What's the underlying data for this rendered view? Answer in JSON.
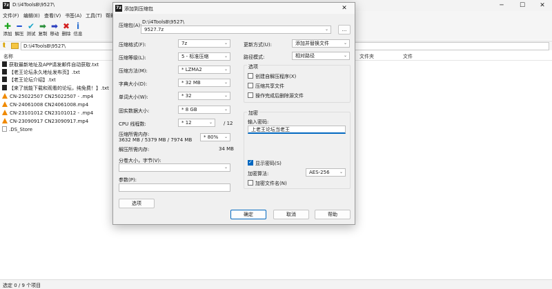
{
  "window": {
    "title": "D:\\i4ToolsB\\9527\\"
  },
  "menu": [
    "文件(F)",
    "编辑(E)",
    "查看(V)",
    "书签(A)",
    "工具(T)",
    "帮助"
  ],
  "toolbar": [
    {
      "label": "添加",
      "icon": "add-icon",
      "glyph": "✚",
      "color": "#1fa51f"
    },
    {
      "label": "解压",
      "icon": "extract-icon",
      "glyph": "━",
      "color": "#1f4fd1"
    },
    {
      "label": "测试",
      "icon": "test-icon",
      "glyph": "✔",
      "color": "#1ea7c9"
    },
    {
      "label": "复制",
      "icon": "copy-icon",
      "glyph": "➡",
      "color": "#2a8f3a"
    },
    {
      "label": "移动",
      "icon": "move-icon",
      "glyph": "➡",
      "color": "#2b3fbf"
    },
    {
      "label": "删除",
      "icon": "delete-icon",
      "glyph": "✖",
      "color": "#d42020"
    },
    {
      "label": "信息",
      "icon": "info-icon",
      "glyph": "i",
      "color": "#2a6fd1"
    }
  ],
  "address": {
    "path": "D:\\i4ToolsB\\9527\\"
  },
  "list_header": {
    "name": "名称",
    "folder": "文件夹",
    "files": "文件"
  },
  "files": [
    {
      "name": "获取最新地址及APP请发邮件自动获取.txt",
      "type": "txt"
    },
    {
      "name": "【老王论坛永久地址发布页】.txt",
      "type": "txt"
    },
    {
      "name": "【老王论坛介绍】.txt",
      "type": "txt"
    },
    {
      "name": "【来了就能下载和观看的论坛，纯免费！】.txt",
      "type": "txt"
    },
    {
      "name": "CN-25022507 CN25022507 - .mp4",
      "type": "mp4"
    },
    {
      "name": "CN-24061008 CN24061008.mp4",
      "type": "mp4"
    },
    {
      "name": "CN-23101012 CN23101012 - .mp4",
      "type": "mp4"
    },
    {
      "name": "CN-23090917 CN23090917.mp4",
      "type": "mp4"
    },
    {
      "name": ".DS_Store",
      "type": "ds"
    }
  ],
  "status": "选定 0 / 9 个项目",
  "dialog": {
    "title": "添加到压缩包",
    "archive_label": "压缩包(A):",
    "archive_dir": "D:\\i4ToolsB\\9527\\",
    "archive_name": "9527.7z",
    "browse_label": "...",
    "format_label": "压缩格式(F):",
    "format_value": "7z",
    "level_label": "压缩等级(L):",
    "level_value": "5 - 标准压缩",
    "method_label": "压缩方法(M):",
    "method_value": "* LZMA2",
    "dict_label": "字典大小(D):",
    "dict_value": "* 32 MB",
    "word_label": "单词大小(W):",
    "word_value": "* 32",
    "solid_label": "固实数据大小:",
    "solid_value": "* 8 GB",
    "threads_label": "CPU 线程数:",
    "threads_value": "* 12",
    "threads_total": "/ 12",
    "mem_label": "压缩所需内存:",
    "mem_value": "3632 MB / 5379 MB / 7974 MB",
    "mem_percent": "* 80%",
    "decomp_label": "解压所需内存:",
    "decomp_value": "34 MB",
    "split_label": "分卷大小，字节(V):",
    "split_value": "",
    "params_label": "参数(P):",
    "params_value": "",
    "options_btn": "选项",
    "update_label": "更新方式(U):",
    "update_value": "添加并替换文件",
    "pathmode_label": "路径模式:",
    "pathmode_value": "相对路径",
    "options_group": "选项",
    "opt_sfx": "创建自解压程序(X)",
    "opt_shared": "压缩共享文件",
    "opt_delete": "操作完成后删除源文件",
    "encrypt_group": "加密",
    "pwd_label": "输入密码:",
    "pwd_value": "上老王论坛当老王",
    "show_pwd": "显示密码(S)",
    "enc_method_label": "加密算法:",
    "enc_method_value": "AES-256",
    "enc_names": "加密文件名(N)",
    "ok": "确定",
    "cancel": "取消",
    "help": "帮助"
  }
}
